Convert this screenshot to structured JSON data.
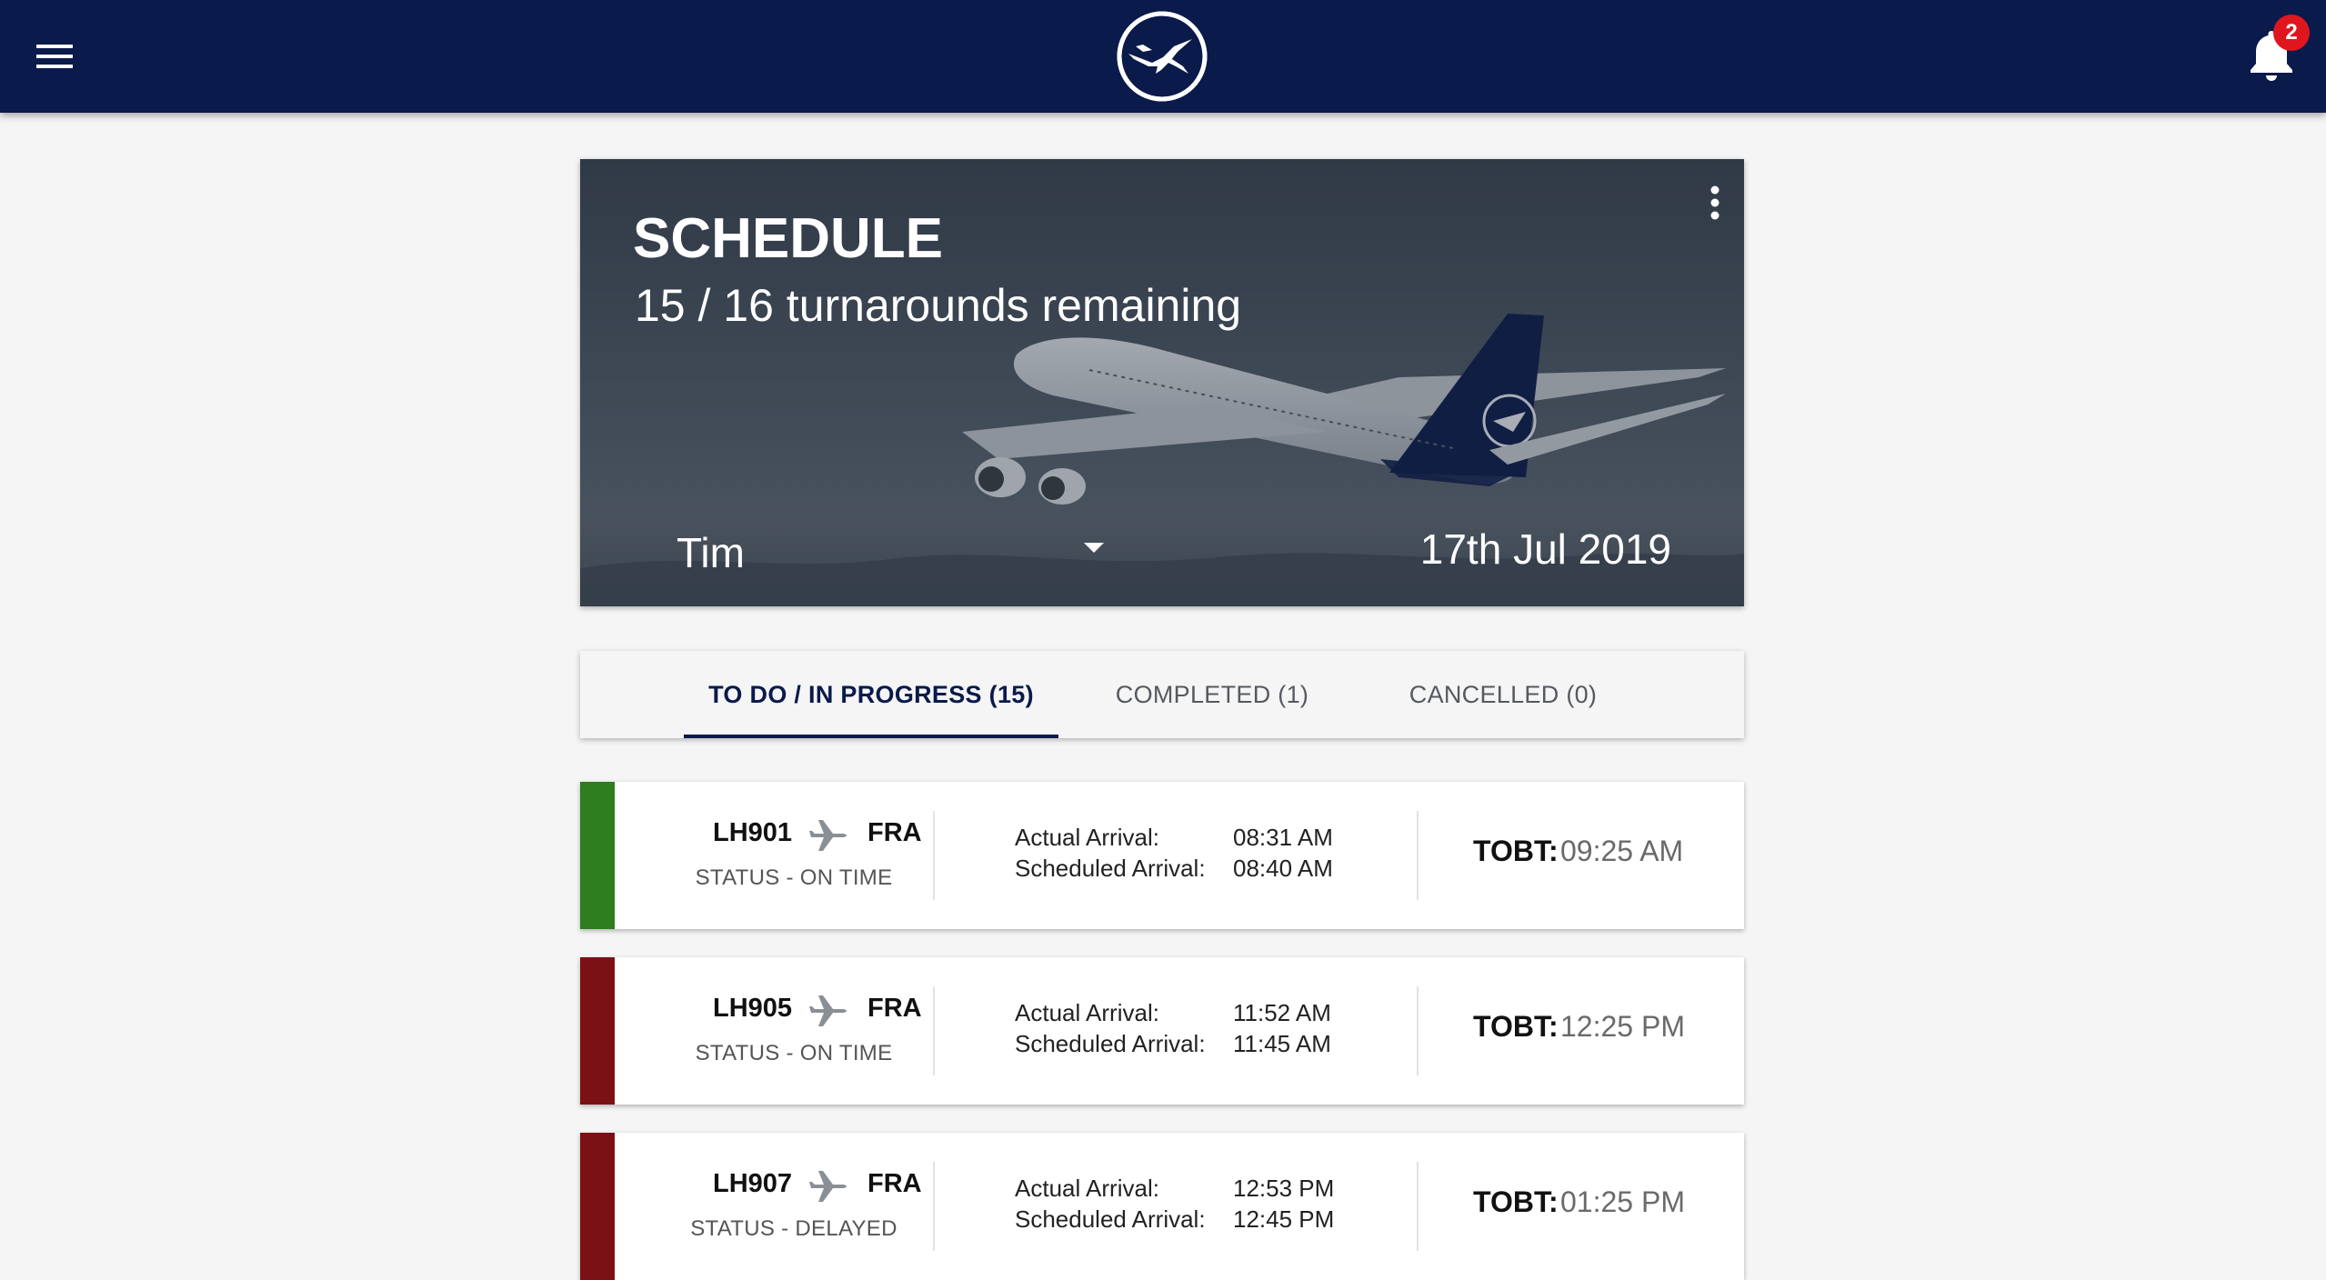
{
  "header": {
    "menu_icon": "hamburger-menu-icon",
    "logo": "lufthansa-crane-logo",
    "notifications": {
      "icon": "bell-icon",
      "count": "2"
    },
    "bar_color": "#0a1a4a",
    "badge_color": "#e0161f"
  },
  "hero": {
    "title": "SCHEDULE",
    "subtitle": "15 / 16 turnarounds remaining",
    "more_icon": "more-vertical-icon",
    "person": "Tim",
    "date": "17th Jul 2019"
  },
  "tabs": [
    {
      "label": "TO DO / IN PROGRESS (15)",
      "active": true
    },
    {
      "label": "COMPLETED (1)",
      "active": false
    },
    {
      "label": "CANCELLED (0)",
      "active": false
    }
  ],
  "flights": [
    {
      "flight_no": "LH901",
      "destination": "FRA",
      "status": "STATUS - ON TIME",
      "status_color": "#2e7d1e",
      "actual_label": "Actual Arrival:",
      "actual_time": "08:31 AM",
      "scheduled_label": "Scheduled Arrival:",
      "scheduled_time": "08:40 AM",
      "tobt_label": "TOBT:",
      "tobt_time": "09:25 AM"
    },
    {
      "flight_no": "LH905",
      "destination": "FRA",
      "status": "STATUS - ON TIME",
      "status_color": "#7a1114",
      "actual_label": "Actual Arrival:",
      "actual_time": "11:52 AM",
      "scheduled_label": "Scheduled Arrival:",
      "scheduled_time": "11:45 AM",
      "tobt_label": "TOBT:",
      "tobt_time": "12:25 PM"
    },
    {
      "flight_no": "LH907",
      "destination": "FRA",
      "status": "STATUS - DELAYED",
      "status_color": "#7a1114",
      "actual_label": "Actual Arrival:",
      "actual_time": "12:53 PM",
      "scheduled_label": "Scheduled Arrival:",
      "scheduled_time": "12:45 PM",
      "tobt_label": "TOBT:",
      "tobt_time": "01:25 PM"
    }
  ]
}
